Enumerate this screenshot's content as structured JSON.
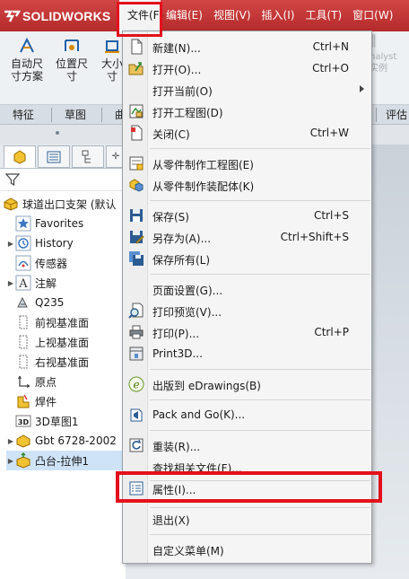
{
  "app": {
    "brand": "SOLIDWORKS"
  },
  "menubar": {
    "items": [
      {
        "label": "文件(F)",
        "active": true
      },
      {
        "label": "编辑(E)"
      },
      {
        "label": "视图(V)"
      },
      {
        "label": "插入(I)"
      },
      {
        "label": "工具(T)"
      },
      {
        "label": "窗口(W)"
      }
    ]
  },
  "toolbar": {
    "buttons": [
      {
        "label_line1": "自动尺",
        "label_line2": "寸方案",
        "icon": "auto-dimension-icon"
      },
      {
        "label_line1": "位置尺",
        "label_line2": "寸",
        "icon": "location-dimension-icon"
      },
      {
        "label_line1": "大小",
        "label_line2": "寸",
        "icon": "size-dimension-icon"
      }
    ],
    "faded_right": {
      "line1": "nalyst",
      "line2": "实例"
    }
  },
  "tabs": [
    {
      "label": "特征"
    },
    {
      "label": "草图"
    },
    {
      "label": "曲"
    },
    {
      "label": "评估"
    }
  ],
  "tree": {
    "root": "球道出口支架 (默认",
    "items": [
      {
        "label": "Favorites",
        "icon": "favorites-star-icon",
        "expandable": false
      },
      {
        "label": "History",
        "icon": "history-icon",
        "expandable": true
      },
      {
        "label": "传感器",
        "icon": "sensor-icon",
        "expandable": false
      },
      {
        "label": "注解",
        "icon": "annotation-icon",
        "expandable": true
      },
      {
        "label": "Q235",
        "icon": "material-icon",
        "expandable": false
      },
      {
        "label": "前视基准面",
        "icon": "plane-icon",
        "expandable": false
      },
      {
        "label": "上视基准面",
        "icon": "plane-icon",
        "expandable": false
      },
      {
        "label": "右视基准面",
        "icon": "plane-icon",
        "expandable": false
      },
      {
        "label": "原点",
        "icon": "origin-icon",
        "expandable": false
      },
      {
        "label": "焊件",
        "icon": "weldment-icon",
        "expandable": false
      },
      {
        "label": "3D草图1",
        "icon": "3d-sketch-icon",
        "expandable": false
      },
      {
        "label": "Gbt 6728-2002",
        "icon": "structure-member-icon",
        "expandable": true
      },
      {
        "label": "凸台-拉伸1",
        "icon": "boss-extrude-icon",
        "expandable": true,
        "selected": true
      }
    ]
  },
  "file_menu": {
    "items": [
      {
        "label": "新建(N)...",
        "shortcut": "Ctrl+N",
        "icon": "new-document-icon"
      },
      {
        "label": "打开(O)...",
        "shortcut": "Ctrl+O",
        "icon": "open-folder-icon"
      },
      {
        "label": "打开当前(O)",
        "submenu": true
      },
      {
        "label": "打开工程图(D)",
        "icon": "open-drawing-icon"
      },
      {
        "label": "关闭(C)",
        "shortcut": "Ctrl+W",
        "icon": "close-document-icon"
      },
      {
        "label": "从零件制作工程图(E)",
        "icon": "make-drawing-icon"
      },
      {
        "label": "从零件制作装配体(K)",
        "icon": "make-assembly-icon"
      },
      {
        "label": "保存(S)",
        "shortcut": "Ctrl+S",
        "icon": "save-icon"
      },
      {
        "label": "另存为(A)...",
        "shortcut": "Ctrl+Shift+S",
        "icon": "save-as-icon"
      },
      {
        "label": "保存所有(L)",
        "icon": "save-all-icon"
      },
      {
        "label": "页面设置(G)..."
      },
      {
        "label": "打印预览(V)...",
        "icon": "print-preview-icon"
      },
      {
        "label": "打印(P)...",
        "shortcut": "Ctrl+P",
        "icon": "print-icon"
      },
      {
        "label": "Print3D...",
        "icon": "print3d-icon"
      },
      {
        "label": "出版到 eDrawings(B)",
        "icon": "edrawings-icon"
      },
      {
        "label": "Pack and Go(K)...",
        "icon": "pack-and-go-icon"
      },
      {
        "label": "重装(R)...",
        "icon": "reload-icon"
      },
      {
        "label": "查找相关文件(F)..."
      },
      {
        "label": "属性(I)...",
        "icon": "properties-icon",
        "highlighted": true
      },
      {
        "label": "退出(X)"
      },
      {
        "label": "自定义菜单(M)"
      }
    ]
  },
  "colors": {
    "titlebar": "#c33333",
    "highlight_box": "#e4111b",
    "tree_selection": "#cfe3f7"
  }
}
